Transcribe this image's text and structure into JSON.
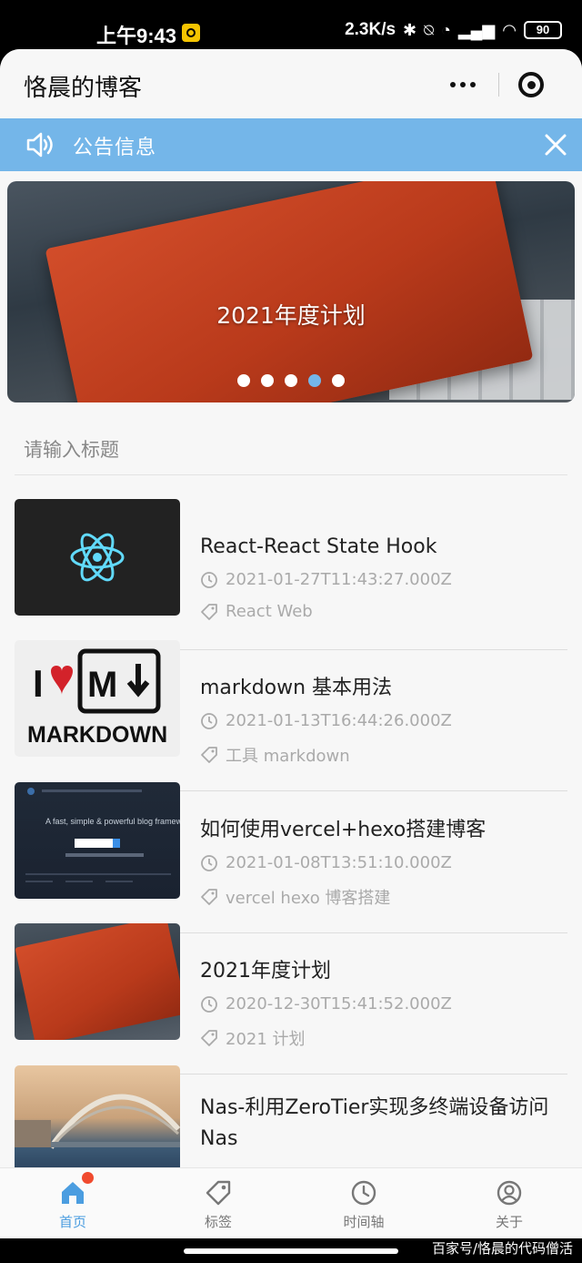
{
  "status_bar": {
    "time": "上午9:43",
    "speed": "2.3K/s",
    "battery": "90"
  },
  "navbar": {
    "title": "恪晨的博客"
  },
  "notice": {
    "text": "公告信息"
  },
  "banner": {
    "title": "2021年度计划",
    "dot_count": 5,
    "active_dot": 4
  },
  "search": {
    "placeholder": "请输入标题"
  },
  "posts": [
    {
      "title": "React-React State Hook",
      "date": "2021-01-27T11:43:27.000Z",
      "tags": "React Web",
      "thumb_icon": "react-logo-icon"
    },
    {
      "title": "markdown 基本用法",
      "date": "2021-01-13T16:44:26.000Z",
      "tags": "工具 markdown",
      "thumb_text_top": "I♥",
      "thumb_text_bottom": "MARKDOWN"
    },
    {
      "title": "如何使用vercel+hexo搭建博客",
      "date": "2021-01-08T13:51:10.000Z",
      "tags": "vercel hexo 博客搭建",
      "thumb_text": "A fast, simple & powerful blog framework"
    },
    {
      "title": "2021年度计划",
      "date": "2020-12-30T15:41:52.000Z",
      "tags": "2021 计划"
    },
    {
      "title": "Nas-利用ZeroTier实现多终端设备访问Nas",
      "date": "",
      "tags": ""
    }
  ],
  "tabbar": {
    "items": [
      {
        "label": "首页",
        "icon": "home-icon"
      },
      {
        "label": "标签",
        "icon": "tag-icon"
      },
      {
        "label": "时间轴",
        "icon": "clock-icon"
      },
      {
        "label": "关于",
        "icon": "user-icon"
      }
    ]
  },
  "watermark": "百家号/恪晨的代码僧活",
  "colors": {
    "accent": "#74b6e9",
    "tab_active": "#4b9de0",
    "badge": "#f04a2e"
  }
}
